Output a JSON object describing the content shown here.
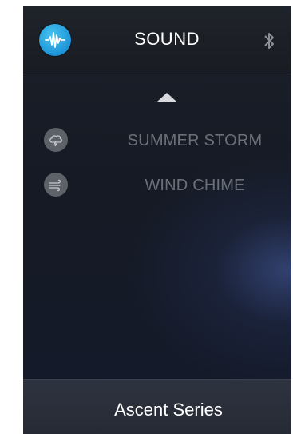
{
  "header": {
    "title": "SOUND",
    "app_icon": "sound-wave-icon",
    "status_icon": "bluetooth-icon"
  },
  "list": {
    "scroll_up_icon": "caret-up-icon",
    "items": [
      {
        "label": "SUMMER STORM",
        "icon": "storm-cloud-icon"
      },
      {
        "label": "WIND CHIME",
        "icon": "wind-icon"
      }
    ]
  },
  "footer": {
    "label": "Ascent Series"
  },
  "colors": {
    "accent": "#1d94d8",
    "text_primary": "#ffffff",
    "text_dim": "#6c7078",
    "icon_circle": "#5d6168"
  }
}
